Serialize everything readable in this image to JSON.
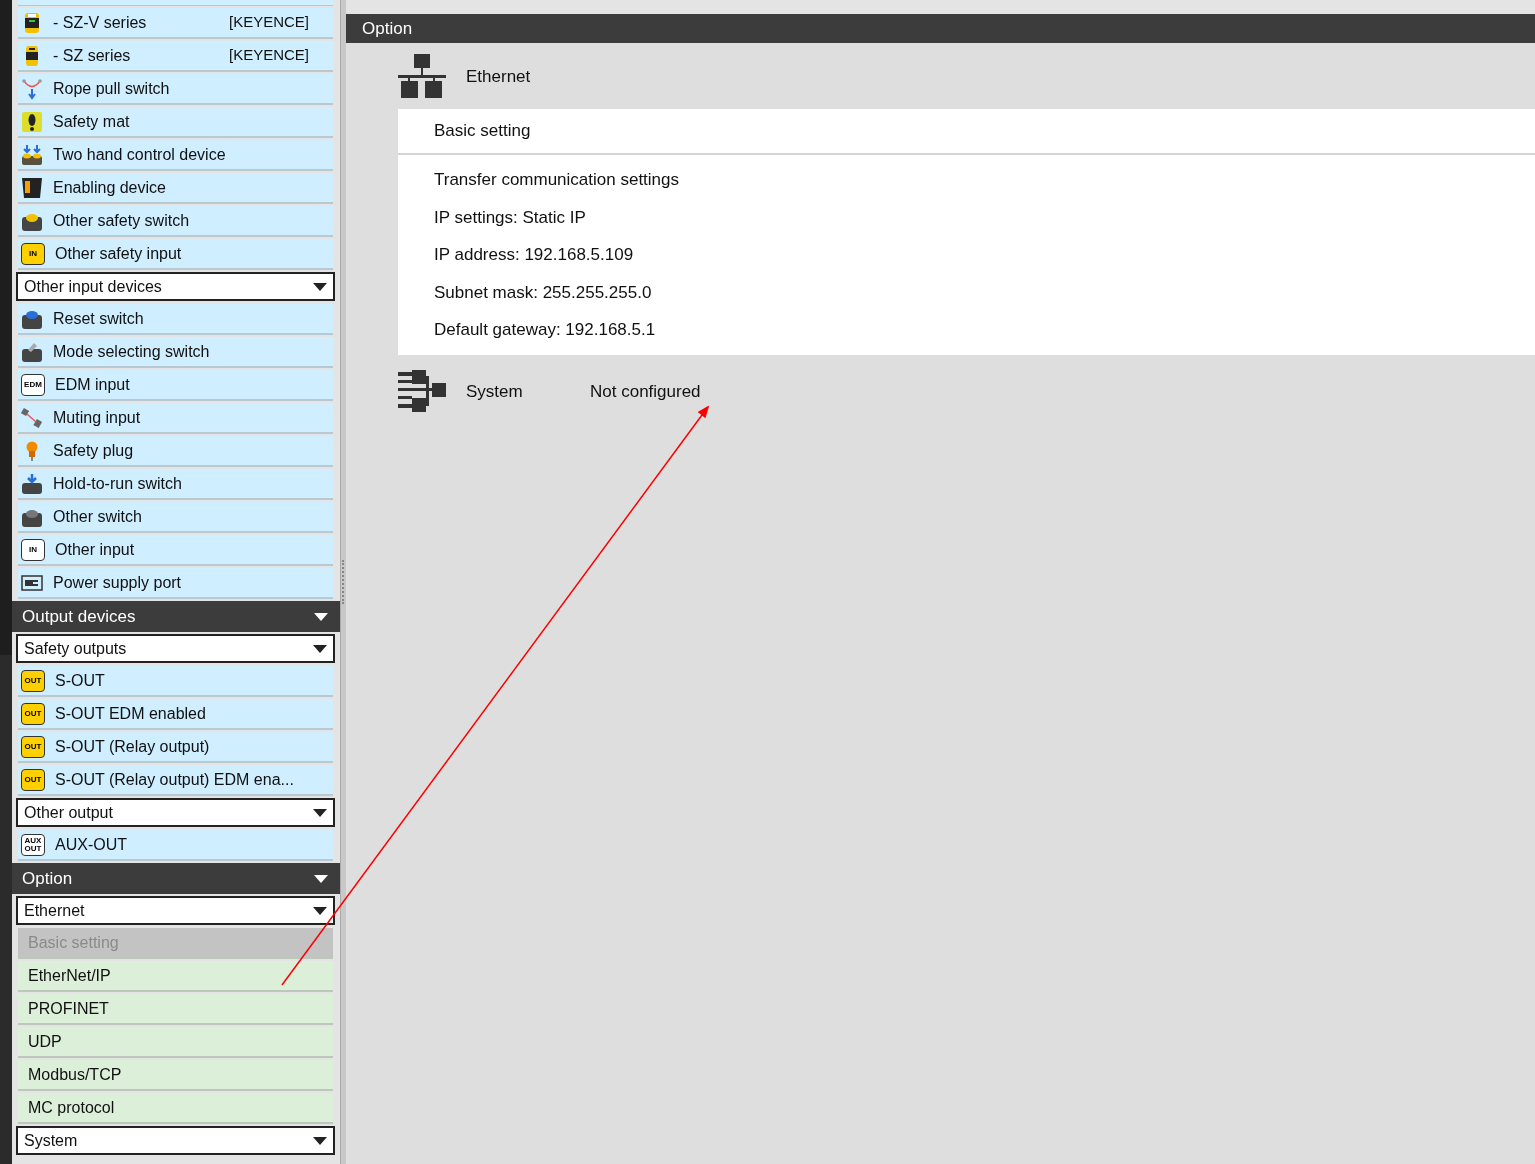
{
  "sidebar": {
    "items": [
      {
        "kind": "device",
        "label": "- SZ-V series",
        "maker": "[KEYENCE]"
      },
      {
        "kind": "device",
        "label": "- SZ series",
        "maker": "[KEYENCE]"
      },
      {
        "kind": "device",
        "label": "Rope pull switch"
      },
      {
        "kind": "device",
        "label": "Safety mat"
      },
      {
        "kind": "device",
        "label": "Two hand control device"
      },
      {
        "kind": "device",
        "label": "Enabling device"
      },
      {
        "kind": "device",
        "label": "Other safety switch"
      },
      {
        "kind": "device",
        "label": "Other safety input",
        "badge": "IN"
      },
      {
        "kind": "dropdown",
        "label": "Other input devices"
      },
      {
        "kind": "device",
        "label": "Reset switch"
      },
      {
        "kind": "device",
        "label": "Mode selecting switch"
      },
      {
        "kind": "device",
        "label": "EDM input",
        "badge": "EDM"
      },
      {
        "kind": "device",
        "label": "Muting input"
      },
      {
        "kind": "device",
        "label": "Safety plug"
      },
      {
        "kind": "device",
        "label": "Hold-to-run switch"
      },
      {
        "kind": "device",
        "label": "Other switch"
      },
      {
        "kind": "device",
        "label": "Other input",
        "badge": "IN"
      },
      {
        "kind": "device",
        "label": "Power supply port"
      },
      {
        "kind": "header",
        "label": "Output devices"
      },
      {
        "kind": "dropdown",
        "label": "Safety outputs"
      },
      {
        "kind": "device",
        "label": "S-OUT",
        "badge": "OUT"
      },
      {
        "kind": "device",
        "label": "S-OUT EDM enabled",
        "badge": "OUT"
      },
      {
        "kind": "device",
        "label": "S-OUT (Relay output)",
        "badge": "OUT"
      },
      {
        "kind": "device",
        "label": "S-OUT (Relay output) EDM ena...",
        "badge": "OUT"
      },
      {
        "kind": "dropdown",
        "label": "Other output"
      },
      {
        "kind": "device",
        "label": "AUX-OUT",
        "badge": "AUX OUT"
      },
      {
        "kind": "header",
        "label": "Option"
      },
      {
        "kind": "dropdown",
        "label": "Ethernet"
      },
      {
        "kind": "subitem",
        "label": "Basic setting",
        "disabled": true
      },
      {
        "kind": "subitem",
        "label": "EtherNet/IP",
        "disabled": false
      },
      {
        "kind": "subitem",
        "label": "PROFINET",
        "disabled": false
      },
      {
        "kind": "subitem",
        "label": "UDP",
        "disabled": false
      },
      {
        "kind": "subitem",
        "label": "Modbus/TCP",
        "disabled": false
      },
      {
        "kind": "subitem",
        "label": "MC protocol",
        "disabled": false
      },
      {
        "kind": "dropdown",
        "label": "System"
      }
    ]
  },
  "main": {
    "header": "Option",
    "sections": [
      {
        "kind": "group",
        "title": "Ethernet",
        "panel": {
          "heading": "Basic setting",
          "lines": [
            "Transfer communication settings",
            "IP settings: Static IP",
            "IP address: 192.168.5.109",
            "Subnet mask: 255.255.255.0",
            "Default gateway: 192.168.5.1"
          ]
        }
      },
      {
        "kind": "status",
        "title": "System",
        "status": "Not configured"
      }
    ]
  }
}
